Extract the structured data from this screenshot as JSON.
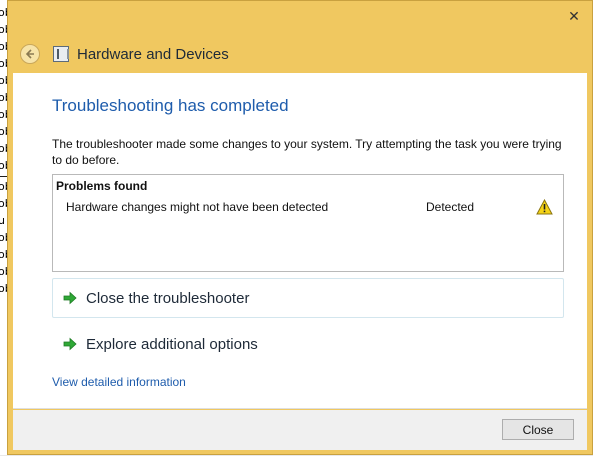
{
  "window": {
    "close_glyph": "✕",
    "frame_color": "#f0c860"
  },
  "nav": {
    "back_icon": "back-arrow-icon",
    "app_icon": "hardware-and-devices-icon",
    "breadcrumb": "Hardware and Devices"
  },
  "main": {
    "heading": "Troubleshooting has completed",
    "description": "The troubleshooter made some changes to your system. Try attempting the task you were trying to do before.",
    "problems": {
      "title": "Problems found",
      "items": [
        {
          "description": "Hardware changes might not have been detected",
          "status": "Detected",
          "icon": "warning-icon"
        }
      ]
    },
    "options": [
      {
        "label": "Close the troubleshooter",
        "icon": "green-arrow-icon"
      },
      {
        "label": "Explore additional options",
        "icon": "green-arrow-icon"
      }
    ],
    "details_link": "View detailed information"
  },
  "footer": {
    "close_label": "Close"
  },
  "background": {
    "fragments": [
      "ob",
      "ob",
      "ob",
      "ob",
      "ob",
      "ob",
      "ob",
      "ob",
      "ob",
      "ob",
      "ob",
      "ob",
      "u",
      "ob",
      "ob",
      "ob",
      "ob"
    ]
  }
}
